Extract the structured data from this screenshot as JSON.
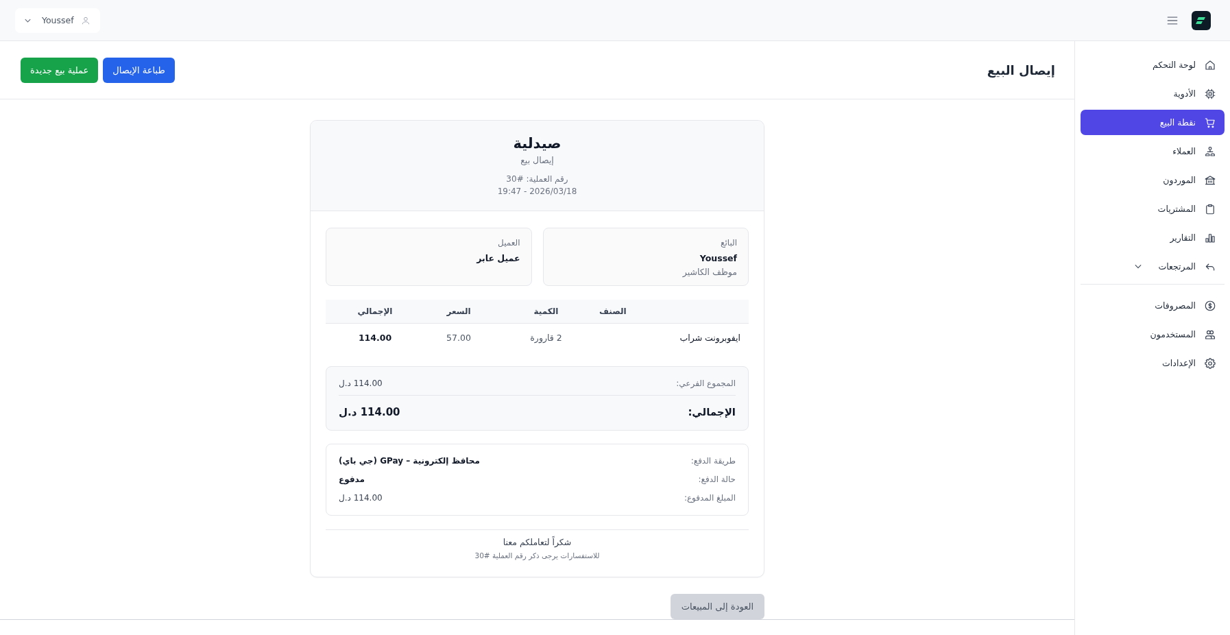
{
  "topbar": {
    "user": "Youssef"
  },
  "sidebar": {
    "sections": [
      {
        "items": [
          {
            "label": "لوحة التحكم",
            "kind": "link",
            "selected": false
          },
          {
            "label": "الأدوية",
            "kind": "link",
            "selected": false
          },
          {
            "label": "نقطة البيع",
            "kind": "link",
            "selected": true
          },
          {
            "label": "العملاء",
            "kind": "link",
            "selected": false
          },
          {
            "label": "الموردون",
            "kind": "link",
            "selected": false
          },
          {
            "label": "المشتريات",
            "kind": "link",
            "selected": false
          },
          {
            "label": "التقارير",
            "kind": "link",
            "selected": false
          },
          {
            "label": "المرتجعات",
            "kind": "group",
            "expanded": false,
            "selected": false
          }
        ]
      },
      {
        "items": [
          {
            "label": "المصروفات",
            "kind": "link",
            "selected": false
          },
          {
            "label": "المستخدمون",
            "kind": "link",
            "selected": false
          },
          {
            "label": "الإعدادات",
            "kind": "link",
            "selected": false
          }
        ]
      }
    ]
  },
  "page": {
    "title": "إيصال البيع",
    "actions": [
      {
        "label": "طباعة الإيصال",
        "kind": "primary"
      },
      {
        "label": "عملية بيع جديدة",
        "kind": "success"
      }
    ]
  },
  "receipt": {
    "store": "صيدلية",
    "subtitle": "إيصال بيع",
    "transaction": "رقم العملية: #30",
    "datetime": "2026/03/18 - 19:47",
    "parties": [
      {
        "label": "البائع",
        "name": "Youssef",
        "role": "موظف الكاشير"
      },
      {
        "label": "العميل",
        "name": "عميل عابر"
      }
    ],
    "table": {
      "columns": [
        "الصنف",
        "الكمية",
        "السعر",
        "الإجمالي"
      ],
      "rows": [
        [
          "ايفوبرونت شراب",
          "2 قارورة",
          "57.00",
          "114.00"
        ]
      ]
    },
    "totals": {
      "subtotal_label": "المجموع الفرعي:",
      "subtotal": "114.00 د.ل",
      "total_label": "الإجمالي:",
      "total": "114.00 د.ل"
    },
    "payment": [
      {
        "label": "طريقة الدفع:",
        "value": "محافظ إلكترونية – GPay (جي باي)",
        "emphasis": true
      },
      {
        "label": "حالة الدفع:",
        "value": "مدفوع",
        "emphasis": true
      },
      {
        "label": "المبلغ المدفوع:",
        "value": "114.00 د.ل",
        "emphasis": false
      }
    ],
    "thanks": "شكراً لتعاملكم معنا",
    "note": "للاستفسارات يرجى ذكر رقم العملية #30"
  },
  "back_button": {
    "label": "العودة إلى المبيعات",
    "kind": "secondary"
  }
}
